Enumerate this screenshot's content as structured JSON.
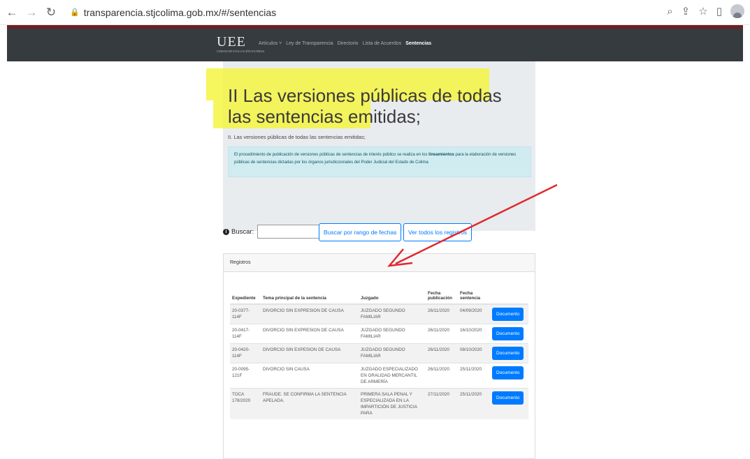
{
  "browser": {
    "url": "transparencia.stjcolima.gob.mx/#/sentencias"
  },
  "site": {
    "logo": "UEE",
    "logo_sub": "UNIDAD DE EVALUACIÓN EXTERNA",
    "menu": [
      "Artículos ˅",
      "Ley de Transparencia",
      "Directorio",
      "Lista de Acuerdos",
      "Sentencias"
    ],
    "title": "II Las versiones públicas de todas las sentencias emitidas;",
    "subtitle": "II. Las versiones públicas de todas las sentencias emitidas;",
    "info_pre": "El procedimiento de publicación de versiones públicas de sentencias de interés público se realiza en los ",
    "info_bold": "lineamientos",
    "info_post": " para la elaboración de versiones públicas de sentencias dictadas por los órganos jurisdiccionales del Poder Judicial del Estado de Colima",
    "search_label": "Buscar:",
    "search_value": "",
    "btn_range": "Buscar por rango de fechas",
    "btn_all": "Ver todos los registros",
    "card_title": "Registros",
    "columns": [
      "Expediente",
      "Tema principal de la sentencia",
      "Juzgado",
      "Fecha publicación",
      "Fecha sentencia",
      ""
    ],
    "rows": [
      {
        "exp": "20-0377-114F",
        "tema": "DIVORCIO SIN EXPRESION DE CAUSA",
        "juzgado": "JUZGADO SEGUNDO FAMILIAR",
        "pub": "26/11/2020",
        "sent": "04/09/2020",
        "btn": "Documento"
      },
      {
        "exp": "20-0417-114F",
        "tema": "DIVORCIO SIN EXPRESION DE CAUSA",
        "juzgado": "JUZGADO SEGUNDO FAMILIAR",
        "pub": "26/11/2020",
        "sent": "16/10/2020",
        "btn": "Documento"
      },
      {
        "exp": "20-0420-114F",
        "tema": "DIVORCIO SIN EXPESION DE CAUSA",
        "juzgado": "JUZGADO SEGUNDO FAMILIAR",
        "pub": "26/11/2020",
        "sent": "08/10/2020",
        "btn": "Documento"
      },
      {
        "exp": "20-0095-121F",
        "tema": "DIVORCIO SIN CAUSA",
        "juzgado": "JUZGADO ESPECIALIZADO EN ORALIDAD MERCANTIL DE ARMERÍA",
        "pub": "26/11/2020",
        "sent": "25/11/2020",
        "btn": "Documento"
      },
      {
        "exp": "TOCA 178/2020",
        "tema": "FRAUDE. SE CONFIRMA LA SENTENCIA APELADA.",
        "juzgado": "PRIMERA SALA PENAL Y ESPECIALIZADA EN LA IMPARTICIÓN DE JUSTICIA PARA",
        "pub": "27/11/2020",
        "sent": "25/11/2020",
        "btn": "Documento"
      }
    ]
  },
  "colors": {
    "highlight": "#f5f542",
    "arrow": "#e0282e",
    "primary": "#007bff",
    "navbar": "#363b40",
    "maroon": "#6d1f24"
  }
}
